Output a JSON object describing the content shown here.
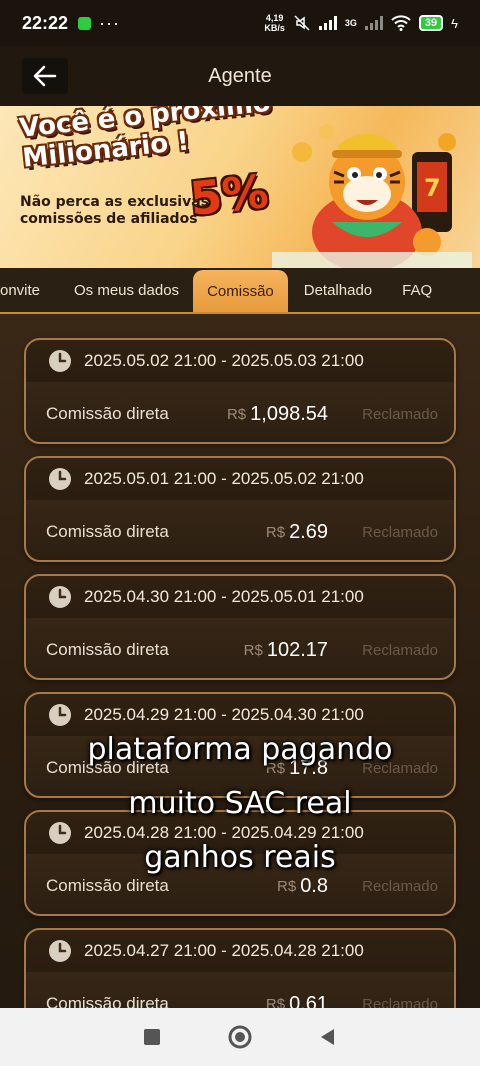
{
  "status_bar": {
    "time": "22:22",
    "dots": "···",
    "speed_top": "4,19",
    "speed_unit": "KB/s",
    "network": "3G",
    "battery": "39"
  },
  "header": {
    "title": "Agente"
  },
  "banner": {
    "headline": "Você é o próximo Milionário !",
    "subtext": "Não perca as exclusivas comissões de afiliados",
    "percent": "5%"
  },
  "tabs": [
    {
      "label": "onvite",
      "active": false
    },
    {
      "label": "Os meus dados",
      "active": false
    },
    {
      "label": "Comissão",
      "active": true
    },
    {
      "label": "Detalhado",
      "active": false
    },
    {
      "label": "FAQ",
      "active": false
    }
  ],
  "currency": "R$",
  "records": [
    {
      "period": "2025.05.02 21:00 - 2025.05.03 21:00",
      "label": "Comissão direta",
      "amount": "1,098.54",
      "status": "Reclamado"
    },
    {
      "period": "2025.05.01 21:00 - 2025.05.02 21:00",
      "label": "Comissão direta",
      "amount": "2.69",
      "status": "Reclamado"
    },
    {
      "period": "2025.04.30 21:00 - 2025.05.01 21:00",
      "label": "Comissão direta",
      "amount": "102.17",
      "status": "Reclamado"
    },
    {
      "period": "2025.04.29 21:00 - 2025.04.30 21:00",
      "label": "Comissão direta",
      "amount": "17.8",
      "status": "Reclamado"
    },
    {
      "period": "2025.04.28 21:00 - 2025.04.29 21:00",
      "label": "Comissão direta",
      "amount": "0.8",
      "status": "Reclamado"
    },
    {
      "period": "2025.04.27 21:00 - 2025.04.28 21:00",
      "label": "Comissão direta",
      "amount": "0.61",
      "status": "Reclamado"
    }
  ],
  "overlay_caption": [
    "plataforma pagando",
    "muito SAC real",
    "ganhos reais"
  ],
  "colors": {
    "accent": "#e89a3c",
    "card_border": "#a7784a",
    "background": "#2a1d10"
  },
  "icons": [
    "back-arrow-icon",
    "clock-icon",
    "square-nav-icon",
    "home-circle-icon",
    "back-triangle-icon"
  ]
}
